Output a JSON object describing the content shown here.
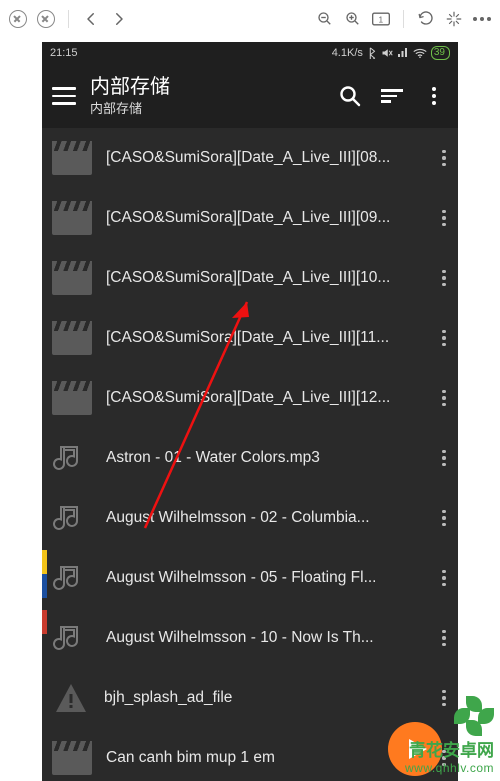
{
  "browser_bar": {
    "close": "×",
    "close2": "×",
    "back": "back",
    "forward": "forward",
    "zoom_out": "−",
    "zoom_in": "+",
    "reset": "1",
    "rotate": "rotate",
    "sparkle": "*",
    "more": "…"
  },
  "status_bar": {
    "time": "21:15",
    "net_speed": "4.1K/s",
    "bt": "bluetooth",
    "mute": "mute",
    "signal": "signal",
    "wifi": "wifi",
    "battery": "39"
  },
  "app_bar": {
    "menu": "menu",
    "title": "内部存储",
    "subtitle": "内部存储",
    "search": "search",
    "sort": "sort",
    "more": "more"
  },
  "files": [
    {
      "name": "[CASO&SumiSora][Date_A_Live_III][08...",
      "icon": "video"
    },
    {
      "name": "[CASO&SumiSora][Date_A_Live_III][09...",
      "icon": "video"
    },
    {
      "name": "[CASO&SumiSora][Date_A_Live_III][10...",
      "icon": "video"
    },
    {
      "name": "[CASO&SumiSora][Date_A_Live_III][11...",
      "icon": "video"
    },
    {
      "name": "[CASO&SumiSora][Date_A_Live_III][12...",
      "icon": "video"
    },
    {
      "name": "Astron - 01 - Water Colors.mp3",
      "icon": "audio"
    },
    {
      "name": "August Wilhelmsson - 02 - Columbia...",
      "icon": "audio"
    },
    {
      "name": "August Wilhelmsson - 05 - Floating Fl...",
      "icon": "audio"
    },
    {
      "name": "August Wilhelmsson - 10 - Now Is Th...",
      "icon": "audio"
    },
    {
      "name": "bjh_splash_ad_file",
      "icon": "warn"
    },
    {
      "name": "Can canh bim mup 1 em",
      "icon": "video"
    }
  ],
  "colors": {
    "accent": "#ff7a1f",
    "brand_green": "#3fa64b"
  },
  "watermark": {
    "zh": "青花安卓网",
    "url": "www.qhhlv.com"
  }
}
